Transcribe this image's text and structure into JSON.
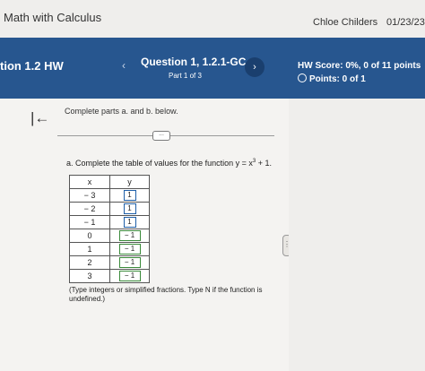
{
  "app": {
    "title": "Math with Calculus"
  },
  "user": {
    "name": "Chloe Childers",
    "date": "01/23/23"
  },
  "header": {
    "section_title": "tion 1.2 HW",
    "question_title": "Question 1, 1.2.1-GC",
    "question_part": "Part 1 of 3",
    "hw_score": "HW Score: 0%, 0 of 11 points",
    "points": "Points: 0 of 1"
  },
  "problem": {
    "instructions": "Complete parts a. and b. below.",
    "more_label": "...",
    "part_a_prefix": "a. Complete the table of values for the function y = x",
    "part_a_exponent": "3",
    "part_a_suffix": " + 1.",
    "table": {
      "headers": [
        "x",
        "y"
      ],
      "rows": [
        {
          "x": "− 3",
          "y": "1"
        },
        {
          "x": "− 2",
          "y": "1"
        },
        {
          "x": "− 1",
          "y": "1"
        },
        {
          "x": "0",
          "y": "− 1"
        },
        {
          "x": "1",
          "y": "− 1"
        },
        {
          "x": "2",
          "y": "− 1"
        },
        {
          "x": "3",
          "y": "− 1"
        }
      ]
    },
    "note": "(Type integers or simplified fractions. Type N if the function is undefined.)"
  },
  "icons": {
    "prev": "chevron-left-icon",
    "next": "chevron-right-icon",
    "back": "collapse-left-icon",
    "points_status": "empty-circle-icon"
  },
  "colors": {
    "header_blue": "#27568f",
    "input_border": "#1f5fa8"
  }
}
